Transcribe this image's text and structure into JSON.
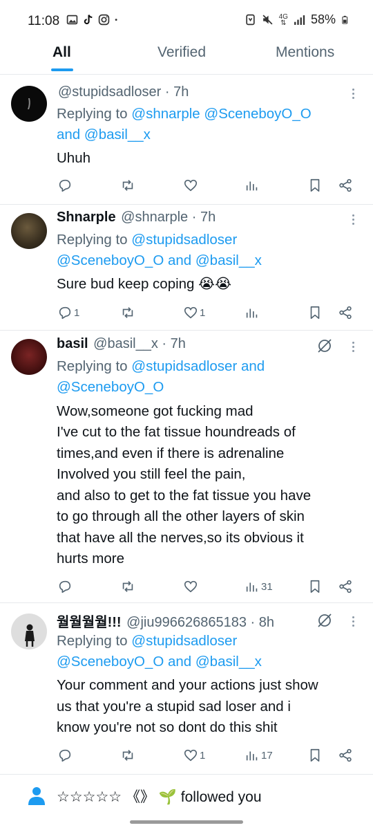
{
  "status_bar": {
    "time": "11:08",
    "left_icons": [
      "image-icon",
      "tiktok-icon",
      "instagram-icon",
      "dot-icon"
    ],
    "right_icons": [
      "nfc-icon",
      "mute-icon",
      "lte-icon",
      "signal-icon"
    ],
    "network": "4G",
    "battery": "58%"
  },
  "tabs": [
    {
      "label": "All",
      "active": true
    },
    {
      "label": "Verified",
      "active": false
    },
    {
      "label": "Mentions",
      "active": false
    }
  ],
  "replies": [
    {
      "name": "",
      "handle": "@stupidsadloser",
      "sep": "·",
      "time": "7h",
      "reply_lines": [
        [
          "Replying to ",
          "@shnarple @SceneboyO_O"
        ],
        [
          "",
          "and @basil__x"
        ]
      ],
      "body": [
        "Uhuh"
      ],
      "replies_count": "",
      "likes": "",
      "views": ""
    },
    {
      "name": "Shnarple",
      "handle": "@shnarple",
      "sep": "·",
      "time": "7h",
      "reply_lines": [
        [
          "Replying to ",
          "@stupidsadloser"
        ],
        [
          "",
          "@SceneboyO_O and @basil__x"
        ]
      ],
      "body": [
        "Sure bud keep coping 😭😭"
      ],
      "replies_count": "1",
      "likes": "1",
      "views": ""
    },
    {
      "name": "basil",
      "handle": "@basil__x",
      "sep": "·",
      "time": "7h",
      "reply_lines": [
        [
          "Replying to ",
          "@stupidsadloser and"
        ],
        [
          "",
          "@SceneboyO_O"
        ]
      ],
      "body": [
        "Wow,someone got fucking mad",
        "I've cut to the fat tissue houndreads of",
        "times,and even if there is adrenaline",
        "Involved you still feel the pain,",
        "and also to get to the fat tissue you have",
        "to go through all the other layers of skin",
        "that have all the nerves,so its obvious it",
        "hurts more"
      ],
      "replies_count": "",
      "likes": "",
      "views": "31"
    },
    {
      "name": "월월월월!!!",
      "handle": "@jiu996626865183",
      "sep": "·",
      "time": "8h",
      "reply_lines": [
        [
          "Replying to ",
          "@stupidsadloser"
        ],
        [
          "",
          "@SceneboyO_O and @basil__x"
        ]
      ],
      "body": [
        "Your comment and your actions just show",
        "us that you're a stupid sad loser and i",
        "know you're not so dont do this shit"
      ],
      "replies_count": "",
      "likes": "1",
      "views": "17"
    }
  ],
  "notification": {
    "text": "☆☆☆☆☆ 《》 🌱 followed you"
  },
  "colors": {
    "accent": "#1d9bf0",
    "secondary_text": "#536471",
    "primary_text": "#0f1419",
    "divider": "#e6e9ec"
  }
}
